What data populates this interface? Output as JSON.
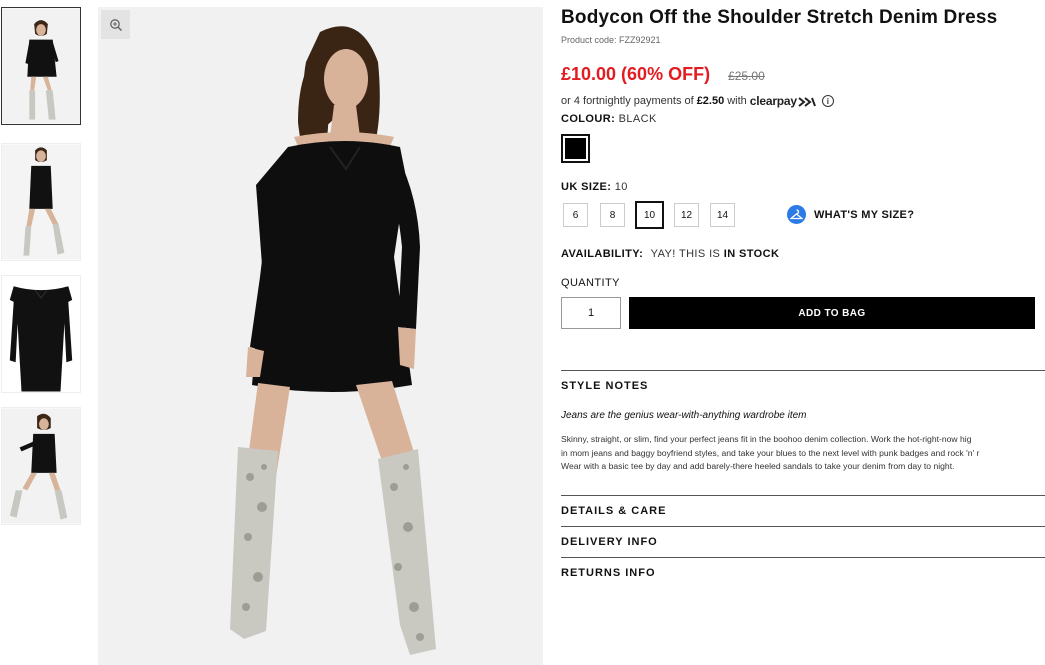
{
  "product": {
    "title": "Bodycon Off the Shoulder Stretch Denim Dress",
    "code": "Product code: FZZ92921",
    "price": "£10.00 (60% OFF)",
    "was_price": "£25.00",
    "price_color": "#e21c21"
  },
  "payments": {
    "prefix": "or 4 fortnightly payments of",
    "amount": "£2.50",
    "with": "with",
    "provider": "clearpay",
    "icon": "info-icon"
  },
  "colour": {
    "label": "COLOUR:",
    "value": "BLACK",
    "swatch_color": "#000000"
  },
  "size": {
    "label": "UK SIZE:",
    "value": "10",
    "options": [
      "6",
      "8",
      "10",
      "12",
      "14"
    ],
    "selected": "10",
    "help_label": "WHAT'S MY SIZE?",
    "help_icon": "hanger-icon"
  },
  "availability": {
    "label": "AVAILABILITY:",
    "text": "YAY! THIS IS",
    "status": "IN STOCK"
  },
  "quantity": {
    "label": "QUANTITY",
    "value": "1"
  },
  "cart": {
    "add_label": "ADD TO BAG"
  },
  "style_notes": {
    "heading": "STYLE NOTES",
    "lead": "Jeans are the genius wear-with-anything wardrobe item",
    "lines": [
      "Skinny, straight, or slim, find your perfect jeans fit in the boohoo denim collection. Work the hot-right-now hig",
      "in mom jeans and baggy boyfriend styles, and take your blues to the next level with punk badges and rock 'n' r",
      "Wear with a basic tee by day and add barely-there heeled sandals to take your denim from day to night."
    ]
  },
  "sections": [
    "DETAILS & CARE",
    "DELIVERY INFO",
    "RETURNS INFO"
  ],
  "gallery": {
    "zoom_icon": "zoom-icon",
    "thumbnails": [
      "thumbnail-1",
      "thumbnail-2",
      "thumbnail-3",
      "thumbnail-4"
    ]
  }
}
